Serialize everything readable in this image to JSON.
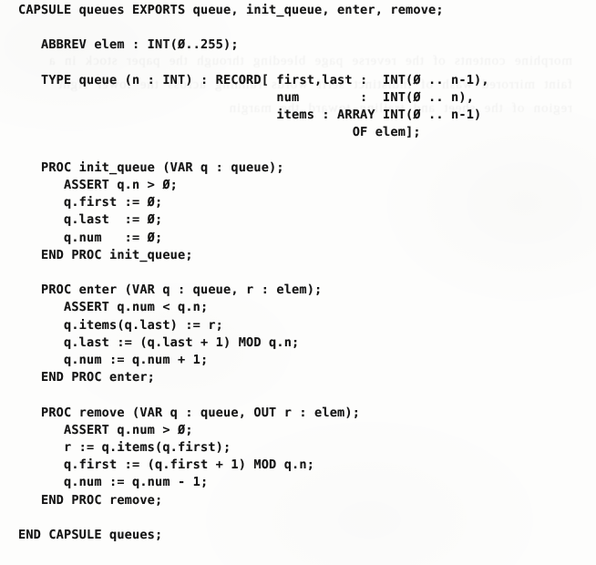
{
  "document": {
    "kind": "source-code-listing",
    "language_keyword": "CAPSULE",
    "module_name": "queues",
    "background_color": "#fdfdfc",
    "text_color": "#151515"
  },
  "listing": {
    "full_text": "CAPSULE queues EXPORTS queue, init_queue, enter, remove;\n\n   ABBREV elem : INT(Ø..255);\n\n   TYPE queue (n : INT) : RECORD[ first,last :  INT(Ø .. n-1),\n                                  num        :  INT(Ø .. n),\n                                  items : ARRAY INT(Ø .. n-1)\n                                            OF elem];\n\n   PROC init_queue (VAR q : queue);\n      ASSERT q.n > Ø;\n      q.first := Ø;\n      q.last  := Ø;\n      q.num   := Ø;\n   END PROC init_queue;\n\n   PROC enter (VAR q : queue, r : elem);\n      ASSERT q.num < q.n;\n      q.items(q.last) := r;\n      q.last := (q.last + 1) MOD q.n;\n      q.num := q.num + 1;\n   END PROC enter;\n\n   PROC remove (VAR q : queue, OUT r : elem);\n      ASSERT q.num > Ø;\n      r := q.items(q.first);\n      q.first := (q.first + 1) MOD q.n;\n      q.num := q.num - 1;\n   END PROC remove;\n\nEND CAPSULE queues;",
    "lines": [
      "CAPSULE queues EXPORTS queue, init_queue, enter, remove;",
      "",
      "   ABBREV elem : INT(Ø..255);",
      "",
      "   TYPE queue (n : INT) : RECORD[ first,last :  INT(Ø .. n-1),",
      "                                  num        :  INT(Ø .. n),",
      "                                  items : ARRAY INT(Ø .. n-1)",
      "                                            OF elem];",
      "",
      "   PROC init_queue (VAR q : queue);",
      "      ASSERT q.n > Ø;",
      "      q.first := Ø;",
      "      q.last  := Ø;",
      "      q.num   := Ø;",
      "   END PROC init_queue;",
      "",
      "   PROC enter (VAR q : queue, r : elem);",
      "      ASSERT q.num < q.n;",
      "      q.items(q.last) := r;",
      "      q.last := (q.last + 1) MOD q.n;",
      "      q.num := q.num + 1;",
      "   END PROC enter;",
      "",
      "   PROC remove (VAR q : queue, OUT r : elem);",
      "      ASSERT q.num > Ø;",
      "      r := q.items(q.first);",
      "      q.first := (q.first + 1) MOD q.n;",
      "      q.num := q.num - 1;",
      "   END PROC remove;",
      "",
      "END CAPSULE queues;"
    ],
    "sections": {
      "header": "CAPSULE queues EXPORTS queue, init_queue, enter, remove;",
      "abbrev": "ABBREV elem : INT(Ø..255);",
      "type_decl_first_line": "TYPE queue (n : INT) : RECORD[ first,last :  INT(Ø .. n-1),",
      "proc_init_queue_header": "PROC init_queue (VAR q : queue);",
      "proc_enter_header": "PROC enter (VAR q : queue, r : elem);",
      "proc_remove_header": "PROC remove (VAR q : queue, OUT r : elem);",
      "footer": "END CAPSULE queues;"
    },
    "exports": [
      "queue",
      "init_queue",
      "enter",
      "remove"
    ],
    "procedures": [
      "init_queue",
      "enter",
      "remove"
    ],
    "record_fields": [
      "first",
      "last",
      "num",
      "items"
    ]
  },
  "scan_artifacts": {
    "ghost_text": "morphine contents of the reverse page bleeding through the paper stock in a faint mirrored wash of indistinct serif words running across the lower right region of the sheet and trailing toward the margin"
  }
}
